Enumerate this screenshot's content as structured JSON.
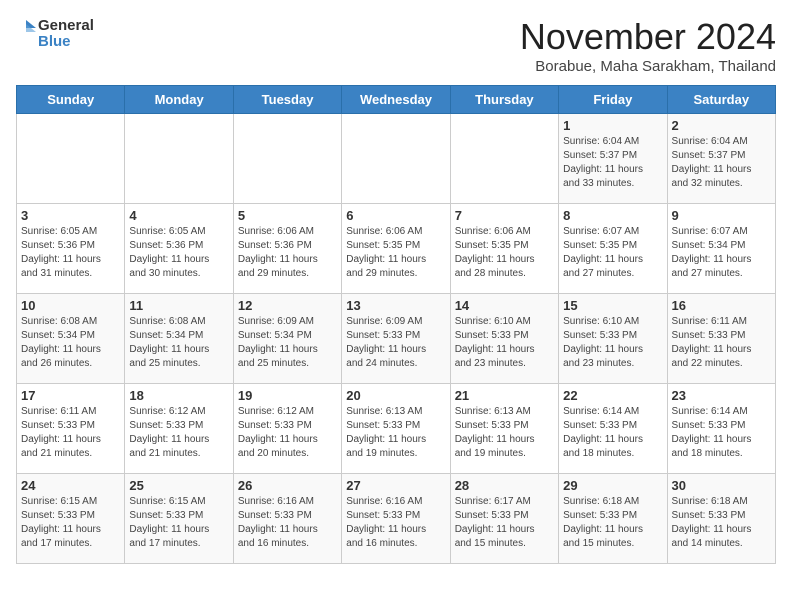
{
  "logo": {
    "general": "General",
    "blue": "Blue"
  },
  "title": "November 2024",
  "subtitle": "Borabue, Maha Sarakham, Thailand",
  "headers": [
    "Sunday",
    "Monday",
    "Tuesday",
    "Wednesday",
    "Thursday",
    "Friday",
    "Saturday"
  ],
  "weeks": [
    [
      {
        "day": "",
        "info": ""
      },
      {
        "day": "",
        "info": ""
      },
      {
        "day": "",
        "info": ""
      },
      {
        "day": "",
        "info": ""
      },
      {
        "day": "",
        "info": ""
      },
      {
        "day": "1",
        "info": "Sunrise: 6:04 AM\nSunset: 5:37 PM\nDaylight: 11 hours\nand 33 minutes."
      },
      {
        "day": "2",
        "info": "Sunrise: 6:04 AM\nSunset: 5:37 PM\nDaylight: 11 hours\nand 32 minutes."
      }
    ],
    [
      {
        "day": "3",
        "info": "Sunrise: 6:05 AM\nSunset: 5:36 PM\nDaylight: 11 hours\nand 31 minutes."
      },
      {
        "day": "4",
        "info": "Sunrise: 6:05 AM\nSunset: 5:36 PM\nDaylight: 11 hours\nand 30 minutes."
      },
      {
        "day": "5",
        "info": "Sunrise: 6:06 AM\nSunset: 5:36 PM\nDaylight: 11 hours\nand 29 minutes."
      },
      {
        "day": "6",
        "info": "Sunrise: 6:06 AM\nSunset: 5:35 PM\nDaylight: 11 hours\nand 29 minutes."
      },
      {
        "day": "7",
        "info": "Sunrise: 6:06 AM\nSunset: 5:35 PM\nDaylight: 11 hours\nand 28 minutes."
      },
      {
        "day": "8",
        "info": "Sunrise: 6:07 AM\nSunset: 5:35 PM\nDaylight: 11 hours\nand 27 minutes."
      },
      {
        "day": "9",
        "info": "Sunrise: 6:07 AM\nSunset: 5:34 PM\nDaylight: 11 hours\nand 27 minutes."
      }
    ],
    [
      {
        "day": "10",
        "info": "Sunrise: 6:08 AM\nSunset: 5:34 PM\nDaylight: 11 hours\nand 26 minutes."
      },
      {
        "day": "11",
        "info": "Sunrise: 6:08 AM\nSunset: 5:34 PM\nDaylight: 11 hours\nand 25 minutes."
      },
      {
        "day": "12",
        "info": "Sunrise: 6:09 AM\nSunset: 5:34 PM\nDaylight: 11 hours\nand 25 minutes."
      },
      {
        "day": "13",
        "info": "Sunrise: 6:09 AM\nSunset: 5:33 PM\nDaylight: 11 hours\nand 24 minutes."
      },
      {
        "day": "14",
        "info": "Sunrise: 6:10 AM\nSunset: 5:33 PM\nDaylight: 11 hours\nand 23 minutes."
      },
      {
        "day": "15",
        "info": "Sunrise: 6:10 AM\nSunset: 5:33 PM\nDaylight: 11 hours\nand 23 minutes."
      },
      {
        "day": "16",
        "info": "Sunrise: 6:11 AM\nSunset: 5:33 PM\nDaylight: 11 hours\nand 22 minutes."
      }
    ],
    [
      {
        "day": "17",
        "info": "Sunrise: 6:11 AM\nSunset: 5:33 PM\nDaylight: 11 hours\nand 21 minutes."
      },
      {
        "day": "18",
        "info": "Sunrise: 6:12 AM\nSunset: 5:33 PM\nDaylight: 11 hours\nand 21 minutes."
      },
      {
        "day": "19",
        "info": "Sunrise: 6:12 AM\nSunset: 5:33 PM\nDaylight: 11 hours\nand 20 minutes."
      },
      {
        "day": "20",
        "info": "Sunrise: 6:13 AM\nSunset: 5:33 PM\nDaylight: 11 hours\nand 19 minutes."
      },
      {
        "day": "21",
        "info": "Sunrise: 6:13 AM\nSunset: 5:33 PM\nDaylight: 11 hours\nand 19 minutes."
      },
      {
        "day": "22",
        "info": "Sunrise: 6:14 AM\nSunset: 5:33 PM\nDaylight: 11 hours\nand 18 minutes."
      },
      {
        "day": "23",
        "info": "Sunrise: 6:14 AM\nSunset: 5:33 PM\nDaylight: 11 hours\nand 18 minutes."
      }
    ],
    [
      {
        "day": "24",
        "info": "Sunrise: 6:15 AM\nSunset: 5:33 PM\nDaylight: 11 hours\nand 17 minutes."
      },
      {
        "day": "25",
        "info": "Sunrise: 6:15 AM\nSunset: 5:33 PM\nDaylight: 11 hours\nand 17 minutes."
      },
      {
        "day": "26",
        "info": "Sunrise: 6:16 AM\nSunset: 5:33 PM\nDaylight: 11 hours\nand 16 minutes."
      },
      {
        "day": "27",
        "info": "Sunrise: 6:16 AM\nSunset: 5:33 PM\nDaylight: 11 hours\nand 16 minutes."
      },
      {
        "day": "28",
        "info": "Sunrise: 6:17 AM\nSunset: 5:33 PM\nDaylight: 11 hours\nand 15 minutes."
      },
      {
        "day": "29",
        "info": "Sunrise: 6:18 AM\nSunset: 5:33 PM\nDaylight: 11 hours\nand 15 minutes."
      },
      {
        "day": "30",
        "info": "Sunrise: 6:18 AM\nSunset: 5:33 PM\nDaylight: 11 hours\nand 14 minutes."
      }
    ]
  ]
}
